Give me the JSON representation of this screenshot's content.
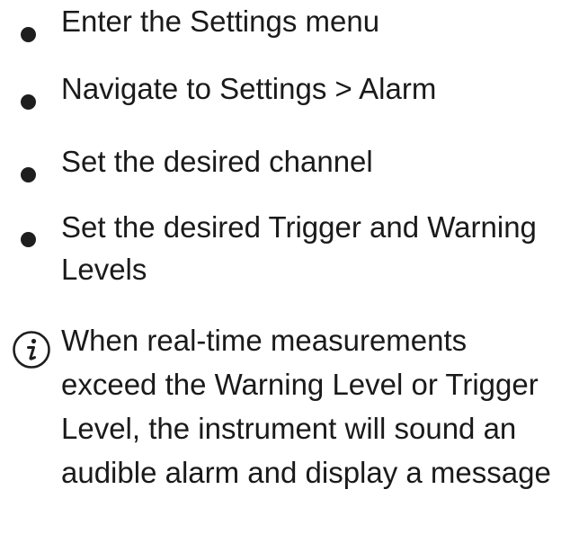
{
  "steps": [
    {
      "text": "Enter the Settings menu"
    },
    {
      "text": "Navigate to Settings > Alarm"
    },
    {
      "text": "Set the desired channel"
    },
    {
      "text": "Set the desired Trigger and Warning Levels"
    }
  ],
  "note": {
    "icon": "info-icon",
    "text": "When real-time measurements exceed the Warning Level or Trigger Level, the instrument will sound an audible alarm and display a message"
  }
}
